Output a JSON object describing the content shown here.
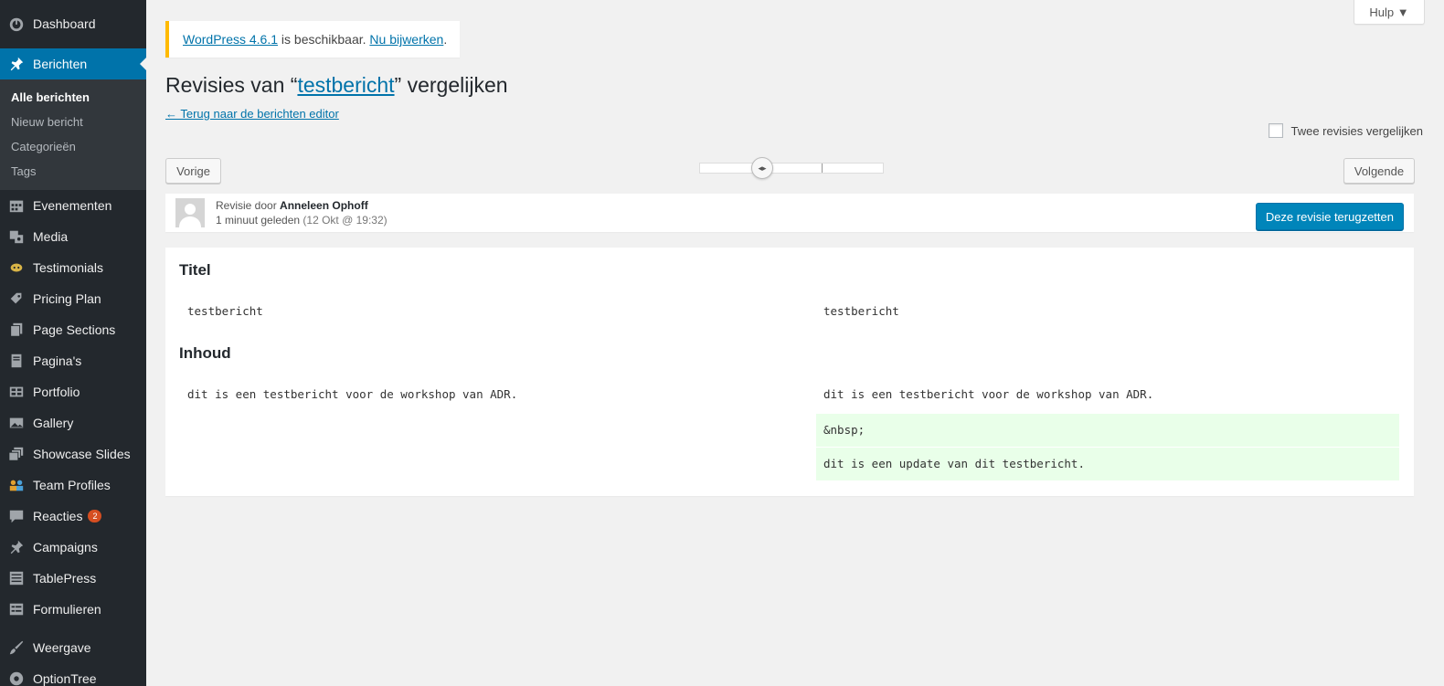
{
  "sidebar": {
    "items_top": [
      {
        "label": "Dashboard",
        "icon": "dashboard-icon"
      }
    ],
    "active": {
      "label": "Berichten",
      "icon": "pin-icon"
    },
    "submenu": [
      "Alle berichten",
      "Nieuw bericht",
      "Categorieën",
      "Tags"
    ],
    "items": [
      {
        "label": "Evenementen",
        "icon": "calendar-icon"
      },
      {
        "label": "Media",
        "icon": "media-icon"
      },
      {
        "label": "Testimonials",
        "icon": "testimonial-icon"
      },
      {
        "label": "Pricing Plan",
        "icon": "tag-icon"
      },
      {
        "label": "Page Sections",
        "icon": "pages-icon"
      },
      {
        "label": "Pagina's",
        "icon": "page-icon"
      },
      {
        "label": "Portfolio",
        "icon": "grid-icon"
      },
      {
        "label": "Gallery",
        "icon": "gallery-icon"
      },
      {
        "label": "Showcase Slides",
        "icon": "slides-icon"
      },
      {
        "label": "Team Profiles",
        "icon": "team-icon"
      },
      {
        "label": "Reacties",
        "icon": "comment-icon",
        "badge": "2"
      },
      {
        "label": "Campaigns",
        "icon": "pin-icon"
      },
      {
        "label": "TablePress",
        "icon": "table-icon"
      },
      {
        "label": "Formulieren",
        "icon": "form-icon"
      }
    ],
    "items_bottom": [
      {
        "label": "Weergave",
        "icon": "brush-icon"
      },
      {
        "label": "OptionTree",
        "icon": "option-icon"
      }
    ]
  },
  "help": {
    "label": "Hulp ▼"
  },
  "notice": {
    "link1": "WordPress 4.6.1",
    "middle": " is beschikbaar. ",
    "link2": "Nu bijwerken",
    "end": "."
  },
  "title": {
    "prefix": "Revisies van “",
    "link": "testbericht",
    "suffix": "” vergelijken"
  },
  "back_link": "← Terug naar de berichten editor",
  "compare_two": "Twee revisies vergelijken",
  "nav": {
    "prev": "Vorige",
    "next": "Volgende"
  },
  "revision": {
    "by": "Revisie door ",
    "author": "Anneleen Ophoff",
    "time": "1 minuut geleden",
    "date": " (12 Okt @ 19:32)",
    "restore": "Deze revisie terugzetten"
  },
  "diff": {
    "title_label": "Titel",
    "title_left": "testbericht",
    "title_right": "testbericht",
    "content_label": "Inhoud",
    "content_left": "dit is een testbericht voor de workshop van ADR.",
    "content_right": "dit is een testbericht voor de workshop van ADR.",
    "added_lines": [
      "&nbsp;",
      "dit is een update van dit testbericht."
    ]
  }
}
